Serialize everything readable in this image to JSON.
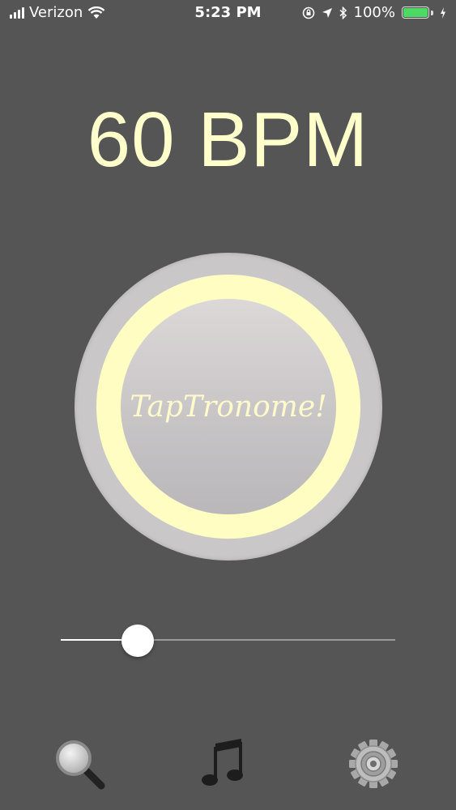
{
  "status_bar": {
    "carrier": "Verizon",
    "time": "5:23 PM",
    "battery": "100%",
    "battery_level": 1.0,
    "icons": [
      "signal-icon",
      "wifi-icon",
      "screen-lock-icon",
      "location-icon",
      "bluetooth-icon",
      "battery-icon",
      "charging-icon"
    ]
  },
  "tempo": {
    "display": "60 BPM"
  },
  "tap_button": {
    "label": "TapTronome!"
  },
  "tempo_slider": {
    "value_fraction": 0.23
  },
  "toolbar": {
    "items": [
      {
        "icon": "magnifier-icon"
      },
      {
        "icon": "music-note-icon"
      },
      {
        "icon": "gear-icon"
      }
    ]
  },
  "colors": {
    "background": "#555555",
    "accent": "#ffffcc",
    "ring": "#fffdc2",
    "button_outer": "#c9c7c8",
    "battery_fill": "#4cd964"
  }
}
